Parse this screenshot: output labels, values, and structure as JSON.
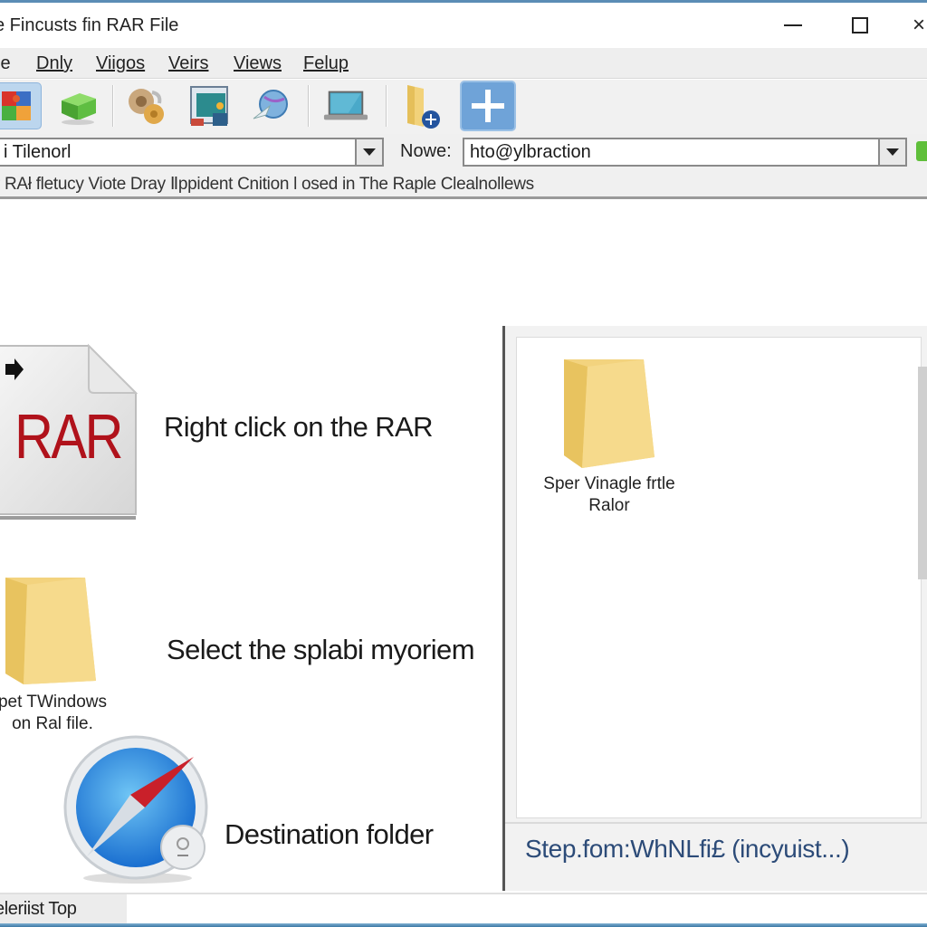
{
  "window": {
    "title": "e Fincusts fin RAR File",
    "controls": {
      "minimize": "minimize",
      "maximize": "maximize",
      "close": "×"
    }
  },
  "menu": {
    "items": [
      {
        "label": "le",
        "underline": ""
      },
      {
        "label": "Dnly",
        "underline": "D"
      },
      {
        "label": "Viigos",
        "underline": "Viig"
      },
      {
        "label": "Veirs",
        "underline": "V"
      },
      {
        "label": "Views",
        "underline": "V"
      },
      {
        "label": "Felup",
        "underline": "F"
      }
    ]
  },
  "toolbar": {
    "buttons": [
      {
        "icon": "colorful-puzzle-icon",
        "active": true
      },
      {
        "icon": "green-box-icon",
        "active": false
      },
      {
        "icon": "settings-gears-icon",
        "active": false
      },
      {
        "icon": "presentation-board-icon",
        "active": false
      },
      {
        "icon": "globe-arrow-icon",
        "active": false
      },
      {
        "icon": "laptop-icon",
        "active": false
      },
      {
        "icon": "folder-add-icon",
        "active": false
      },
      {
        "icon": "plus-icon",
        "active": true
      }
    ]
  },
  "address": {
    "path_value": "i Tilenorl",
    "name_label": "Nowe:",
    "name_value": "hto@ylbraction"
  },
  "info": {
    "text": "r RAł fletucy Viote Dray Ⅱppident Cnition l osed in The Raple Clealnollews"
  },
  "steps": [
    {
      "text": "Right click on the RAR",
      "icon": "rar-file-icon",
      "icon_label": "RAR"
    },
    {
      "text": "Select the splabi myoriem",
      "icon": "folder-icon",
      "caption_line1": "pet TWindows",
      "caption_line2": "on Ral file."
    },
    {
      "text": "Destination folder",
      "icon": "compass-icon"
    }
  ],
  "right_panel": {
    "folder": {
      "caption_line1": "Sper Vinagle frtle",
      "caption_line2": "Ralor"
    },
    "status_text": "Step.fom:WhNLfi£ (incyuist...)"
  },
  "statusbar": {
    "text": "eleriist Top"
  },
  "colors": {
    "accent_blue": "#2c4b78",
    "rar_red": "#b0121b",
    "active_button": "#bcd6ee",
    "folder_yellow": "#f2d27a"
  }
}
